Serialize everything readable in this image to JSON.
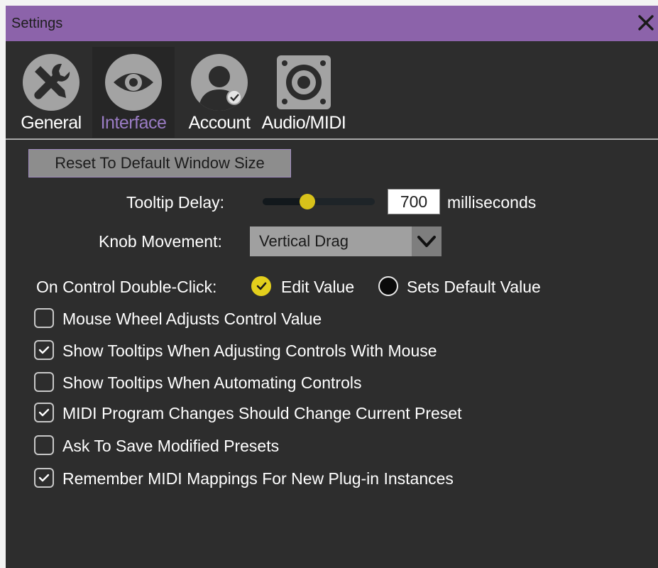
{
  "window": {
    "title": "Settings"
  },
  "tabs": [
    {
      "label": "General",
      "icon": "wrench-screwdriver-icon",
      "selected": false
    },
    {
      "label": "Interface",
      "icon": "eye-icon",
      "selected": true
    },
    {
      "label": "Account",
      "icon": "user-icon",
      "selected": false
    },
    {
      "label": "Audio/MIDI",
      "icon": "speaker-icon",
      "selected": false
    }
  ],
  "interface": {
    "reset_button_label": "Reset To Default Window Size",
    "tooltip_delay": {
      "label": "Tooltip Delay:",
      "value": "700",
      "unit": "milliseconds",
      "slider_fraction": 0.4
    },
    "knob_movement": {
      "label": "Knob Movement:",
      "selected": "Vertical Drag"
    },
    "double_click": {
      "label": "On Control Double-Click:",
      "options": [
        {
          "label": "Edit Value",
          "selected": true
        },
        {
          "label": "Sets Default Value",
          "selected": false
        }
      ]
    },
    "checkboxes": [
      {
        "label": "Mouse Wheel Adjusts Control Value",
        "checked": false
      },
      {
        "label": "Show Tooltips When Adjusting Controls With Mouse",
        "checked": true
      },
      {
        "label": "Show Tooltips When Automating Controls",
        "checked": false
      },
      {
        "label": "MIDI Program Changes Should Change Current Preset",
        "checked": true
      },
      {
        "label": "Ask To Save Modified Presets",
        "checked": false
      },
      {
        "label": "Remember MIDI Mappings For New Plug-in Instances",
        "checked": true
      }
    ]
  },
  "colors": {
    "titlebar": "#8c63aa",
    "panel": "#2d2d2d",
    "accent_yellow": "#e3cf1c",
    "selected_tab_text": "#9a7cc4"
  }
}
